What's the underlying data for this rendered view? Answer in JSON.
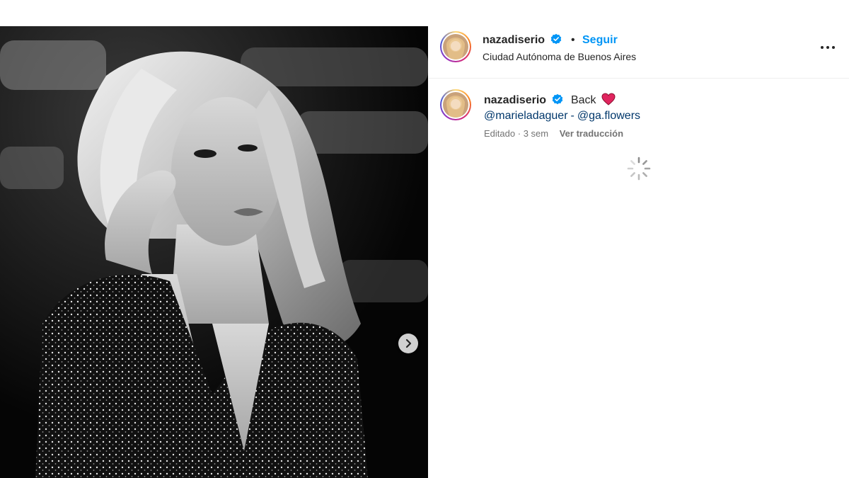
{
  "post": {
    "username": "nazadiserio",
    "verified": true,
    "separator": "•",
    "follow_label": "Seguir",
    "location": "Ciudad Autónoma de Buenos Aires",
    "more_icon": "more-horizontal-icon",
    "carousel_next_icon": "chevron-right-icon"
  },
  "caption": {
    "username": "nazadiserio",
    "text": "Back",
    "emoji": "red-heart",
    "mention_1": "@marieladaguer",
    "separator": "-",
    "mention_2": "@ga.flowers",
    "edited_label": "Editado",
    "dot": "·",
    "time_ago": "3 sem",
    "translate_label": "Ver traducción"
  },
  "colors": {
    "link_blue": "#0095f6",
    "mention_blue": "#00376b",
    "verified_blue": "#0095f6",
    "muted": "#737373",
    "heart_red": "#e0245e"
  }
}
